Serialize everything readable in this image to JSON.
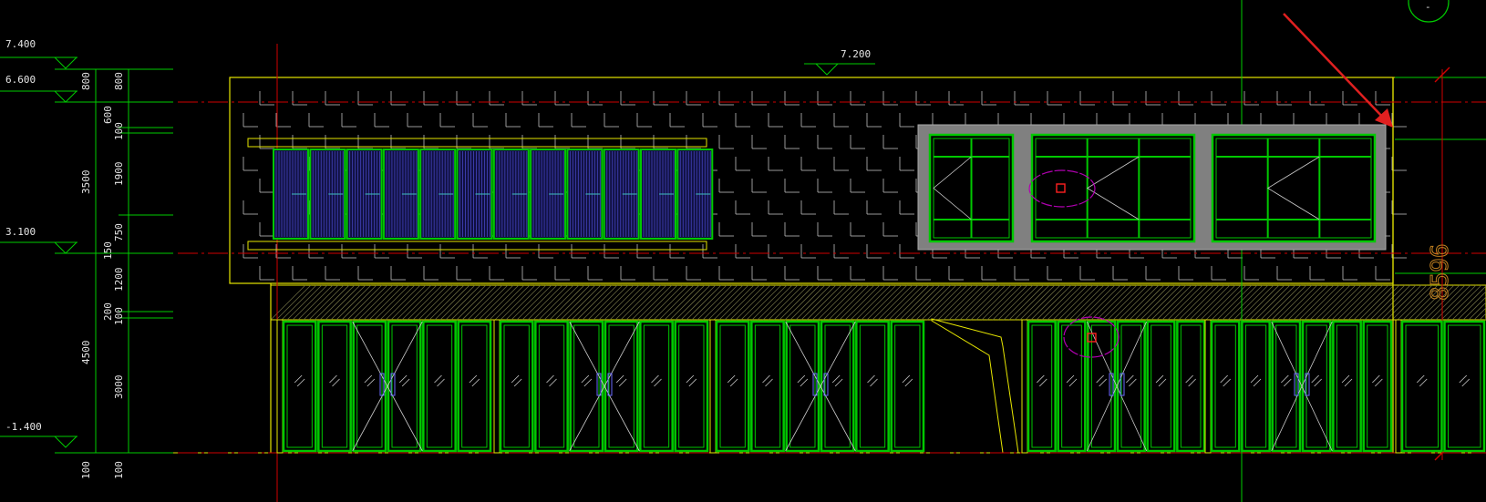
{
  "levels": [
    "7.400",
    "6.600",
    "3.100",
    "-1.400",
    "7.200"
  ],
  "dims_outer": [
    "800",
    "3500",
    "4500",
    "100"
  ],
  "dims_inner": [
    "800",
    "600",
    "100",
    "1900",
    "750",
    "150",
    "1200",
    "200",
    "100",
    "3000",
    "100"
  ],
  "side_dim": "8596",
  "corner_mark": "-",
  "colors": {
    "background": "#000000",
    "outline": "#e6e600",
    "frames": "#00c800",
    "axis": "#d00000",
    "dimension": "#00cc00",
    "grid": "#bfbfbf",
    "arrow": "#e02020",
    "panel": "#808080",
    "cloud": "#b000b0",
    "louver": "#3a3aa8",
    "hatch": "#6a6a40"
  }
}
